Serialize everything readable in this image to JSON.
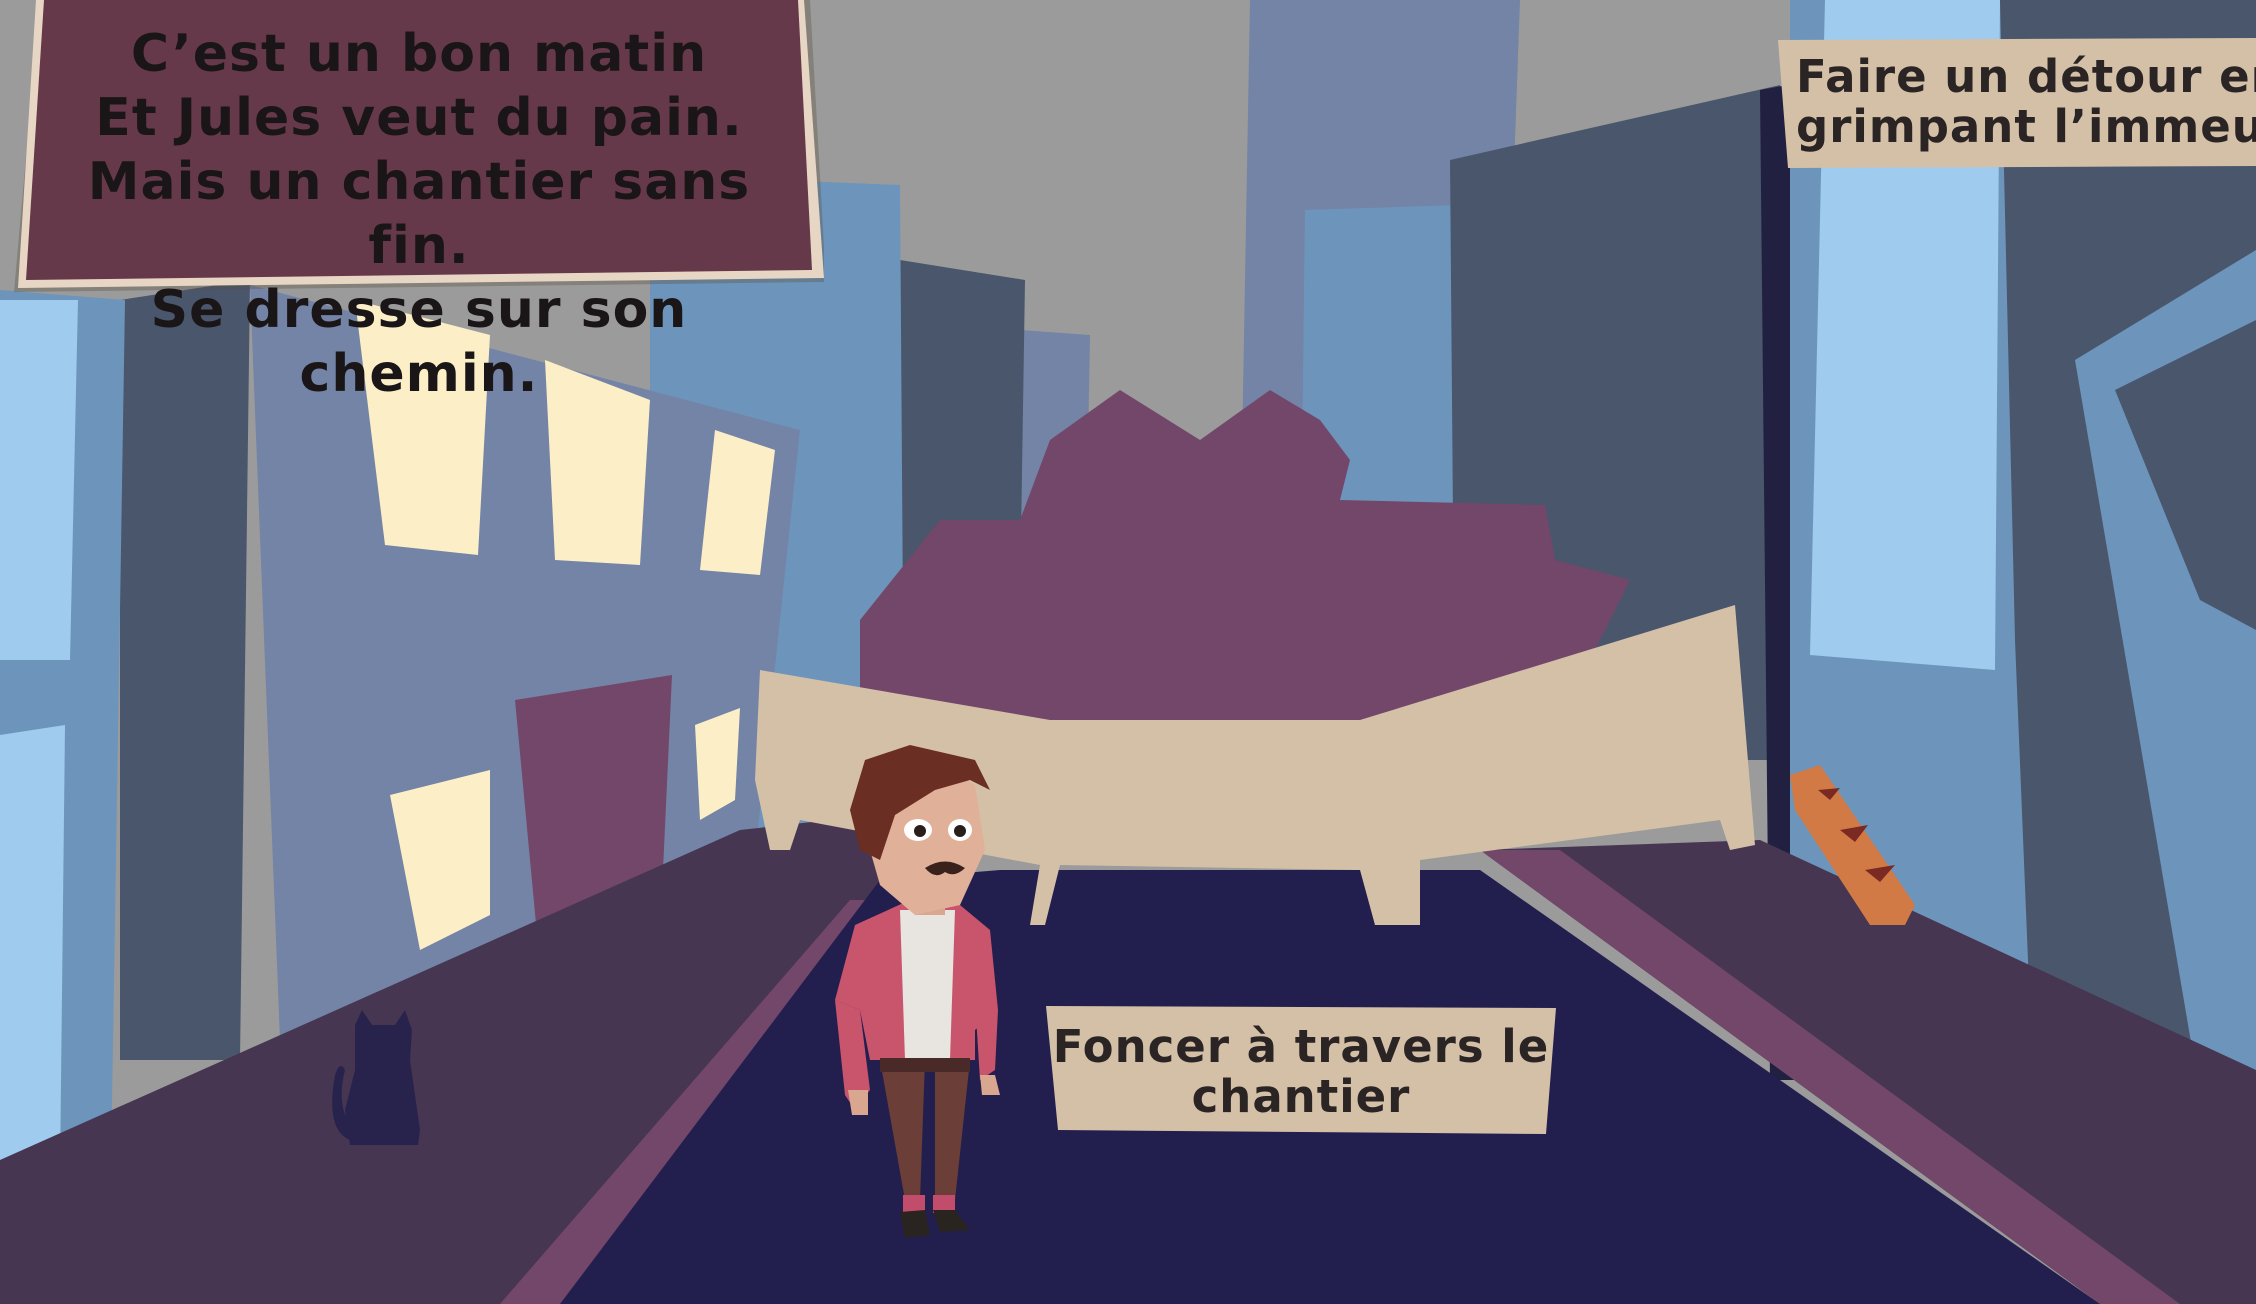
{
  "story": {
    "lines": [
      "C’est un bon matin",
      "Et Jules veut du pain.",
      "Mais un chantier sans fin.",
      "Se dresse sur son chemin."
    ]
  },
  "choices": [
    {
      "id": "through",
      "lines": [
        "Foncer à travers le",
        "chantier"
      ]
    },
    {
      "id": "detour",
      "lines": [
        "Faire un détour en",
        "grimpant l’immeuble"
      ]
    }
  ],
  "colors": {
    "sky": "#9b9b9b",
    "building_light": "#6d95bb",
    "building_mid": "#7484a6",
    "building_dark": "#4a566c",
    "window_warm": "#fcefc8",
    "road": "#221f4e",
    "sidewalk": "#463651",
    "rubble": "#734769",
    "barrier": "#d4c0a7",
    "story_panel": "#66394a",
    "choice_panel": "#d4c0a7"
  }
}
